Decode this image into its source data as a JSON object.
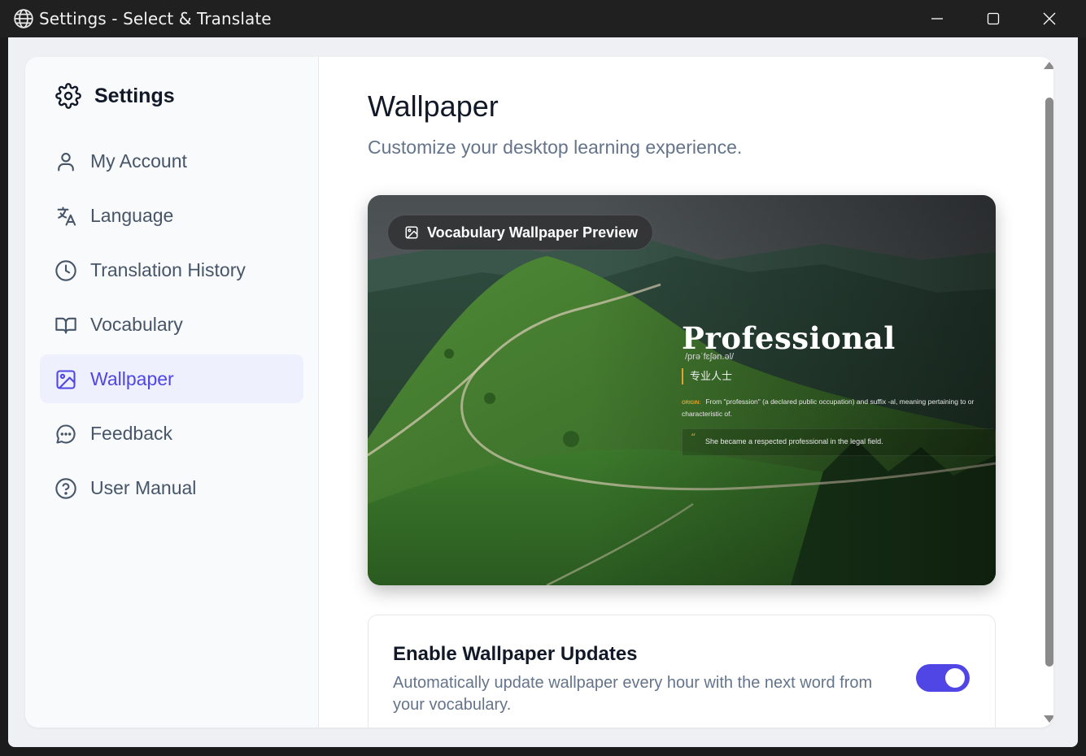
{
  "window": {
    "title": "Settings - Select & Translate",
    "app_icon": "globe-icon",
    "controls": [
      "minimize-icon",
      "maximize-icon",
      "close-icon"
    ]
  },
  "sidebar": {
    "title": "Settings",
    "title_icon": "gear-icon",
    "items": [
      {
        "label": "My Account",
        "icon": "user-icon",
        "active": false
      },
      {
        "label": "Language",
        "icon": "translate-icon",
        "active": false
      },
      {
        "label": "Translation History",
        "icon": "clock-icon",
        "active": false
      },
      {
        "label": "Vocabulary",
        "icon": "book-open-icon",
        "active": false
      },
      {
        "label": "Wallpaper",
        "icon": "image-icon",
        "active": true
      },
      {
        "label": "Feedback",
        "icon": "chat-bubble-icon",
        "active": false
      },
      {
        "label": "User Manual",
        "icon": "help-circle-icon",
        "active": false
      }
    ]
  },
  "main": {
    "title": "Wallpaper",
    "subtitle": "Customize your desktop learning experience.",
    "preview": {
      "label": "Vocabulary Wallpaper Preview",
      "icon": "image-icon",
      "word": "Professional",
      "phonetic": "/prəˈfɛʃən.əl/",
      "translation": "专业人士",
      "origin_label": "ORIGIN:",
      "origin_text": "From \"profession\" (a declared public occupation) and suffix -al, meaning pertaining to or characteristic of.",
      "example": "She became a respected professional in the legal field."
    },
    "setting": {
      "title": "Enable Wallpaper Updates",
      "description": "Automatically update wallpaper every hour with the next word from your vocabulary.",
      "enabled": true
    }
  },
  "colors": {
    "accent": "#4f46e5",
    "active_bg": "#eef0fe",
    "origin_accent": "#e3a32b"
  }
}
